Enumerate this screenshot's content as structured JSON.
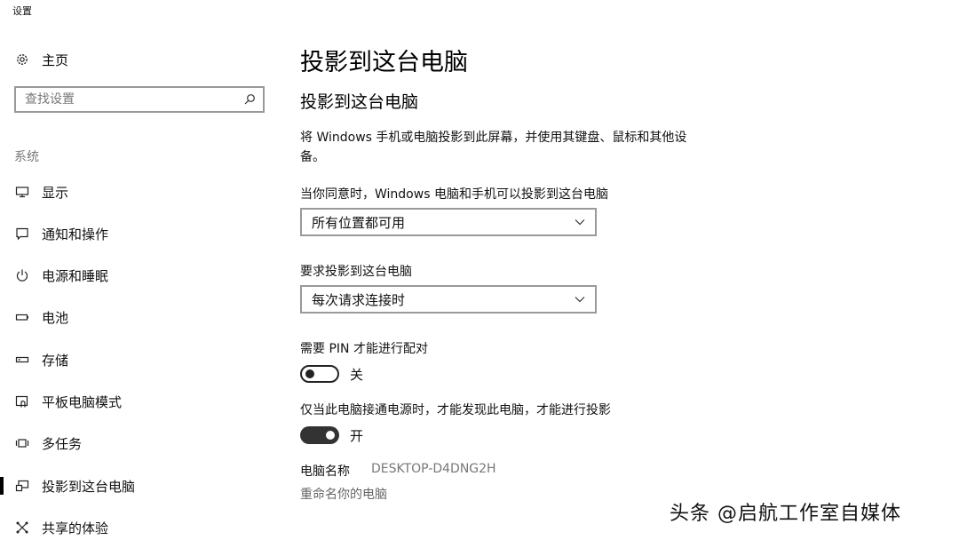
{
  "app_title": "设置",
  "sidebar": {
    "home_label": "主页",
    "search_placeholder": "查找设置",
    "section_label": "系统",
    "items": [
      {
        "label": "显示",
        "icon": "monitor-icon"
      },
      {
        "label": "通知和操作",
        "icon": "notification-icon"
      },
      {
        "label": "电源和睡眠",
        "icon": "power-icon"
      },
      {
        "label": "电池",
        "icon": "battery-icon"
      },
      {
        "label": "存储",
        "icon": "storage-icon"
      },
      {
        "label": "平板电脑模式",
        "icon": "tablet-mode-icon"
      },
      {
        "label": "多任务",
        "icon": "multitasking-icon"
      },
      {
        "label": "投影到这台电脑",
        "icon": "project-icon",
        "active": true
      },
      {
        "label": "共享的体验",
        "icon": "shared-experiences-icon"
      }
    ]
  },
  "main": {
    "page_title": "投影到这台电脑",
    "sub_title": "投影到这台电脑",
    "description": "将 Windows 手机或电脑投影到此屏幕，并使用其键盘、鼠标和其他设备。",
    "allow_label": "当你同意时，Windows 电脑和手机可以投影到这台电脑",
    "allow_value": "所有位置都可用",
    "ask_label": "要求投影到这台电脑",
    "ask_value": "每次请求连接时",
    "pin_label": "需要 PIN 才能进行配对",
    "pin_state": "关",
    "pin_on": false,
    "power_label": "仅当此电脑接通电源时，才能发现此电脑，才能进行投影",
    "power_state": "开",
    "power_on": true,
    "pc_name_label": "电脑名称",
    "pc_name_value": "DESKTOP-D4DNG2H",
    "rename_link": "重命名你的电脑"
  },
  "watermark": "头条 @启航工作室自媒体"
}
